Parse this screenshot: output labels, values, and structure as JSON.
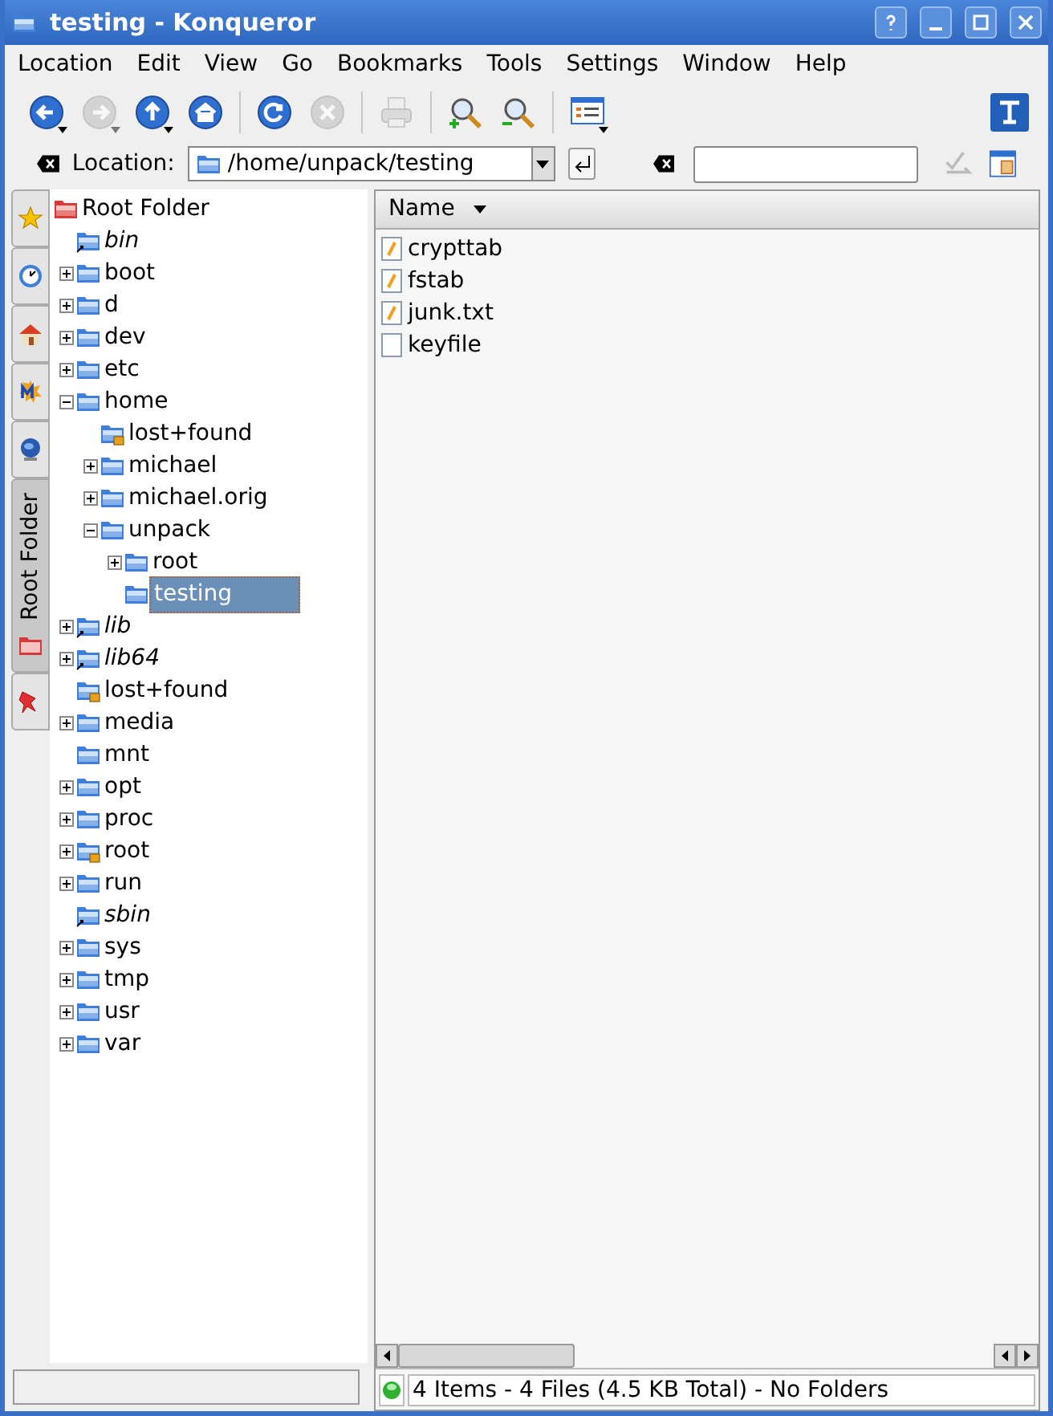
{
  "window": {
    "title": "testing - Konqueror"
  },
  "menu": [
    "Location",
    "Edit",
    "View",
    "Go",
    "Bookmarks",
    "Tools",
    "Settings",
    "Window",
    "Help"
  ],
  "toolbar": [
    {
      "kind": "back",
      "disabled": false,
      "dropdown": true
    },
    {
      "kind": "forward",
      "disabled": true,
      "dropdown": true
    },
    {
      "kind": "up",
      "disabled": false,
      "dropdown": true
    },
    {
      "kind": "home",
      "disabled": false,
      "dropdown": false
    },
    {
      "kind": "sep"
    },
    {
      "kind": "reload",
      "disabled": false,
      "dropdown": false
    },
    {
      "kind": "stop",
      "disabled": true,
      "dropdown": false
    },
    {
      "kind": "sep"
    },
    {
      "kind": "print",
      "disabled": true,
      "dropdown": false
    },
    {
      "kind": "sep"
    },
    {
      "kind": "zoomin",
      "disabled": false,
      "dropdown": false
    },
    {
      "kind": "zoomout",
      "disabled": false,
      "dropdown": false
    },
    {
      "kind": "sep"
    },
    {
      "kind": "viewmode",
      "disabled": false,
      "dropdown": true
    }
  ],
  "location": {
    "label": "Location:",
    "value": "/home/unpack/testing"
  },
  "sidebar_tabs": [
    {
      "kind": "bookmarks",
      "selected": false
    },
    {
      "kind": "history",
      "selected": false
    },
    {
      "kind": "home",
      "selected": false
    },
    {
      "kind": "media",
      "selected": false
    },
    {
      "kind": "network",
      "selected": false
    },
    {
      "kind": "root",
      "label": "Root Folder",
      "selected": true
    },
    {
      "kind": "services",
      "selected": false
    }
  ],
  "tree": {
    "label": "Root Folder",
    "children": [
      {
        "label": "bin",
        "kind": "symlink",
        "selected": false
      },
      {
        "label": "boot",
        "kind": "folder",
        "expanded": false,
        "selected": false
      },
      {
        "label": "d",
        "kind": "folder",
        "expanded": false,
        "selected": false
      },
      {
        "label": "dev",
        "kind": "folder",
        "expanded": false,
        "selected": false
      },
      {
        "label": "etc",
        "kind": "folder",
        "expanded": false,
        "selected": false
      },
      {
        "label": "home",
        "kind": "folder",
        "expanded": true,
        "selected": false,
        "children": [
          {
            "label": "lost+found",
            "kind": "locked",
            "selected": false
          },
          {
            "label": "michael",
            "kind": "folder",
            "expanded": false,
            "selected": false
          },
          {
            "label": "michael.orig",
            "kind": "folder",
            "expanded": false,
            "selected": false
          },
          {
            "label": "unpack",
            "kind": "folder",
            "expanded": true,
            "selected": false,
            "children": [
              {
                "label": "root",
                "kind": "folder",
                "expanded": false,
                "selected": false
              },
              {
                "label": "testing",
                "kind": "folder",
                "selected": true
              }
            ]
          }
        ]
      },
      {
        "label": "lib",
        "kind": "symlink",
        "expanded": false,
        "selected": false
      },
      {
        "label": "lib64",
        "kind": "symlink",
        "expanded": false,
        "selected": false
      },
      {
        "label": "lost+found",
        "kind": "locked",
        "selected": false
      },
      {
        "label": "media",
        "kind": "folder",
        "expanded": false,
        "selected": false
      },
      {
        "label": "mnt",
        "kind": "folder",
        "selected": false
      },
      {
        "label": "opt",
        "kind": "folder",
        "expanded": false,
        "selected": false
      },
      {
        "label": "proc",
        "kind": "folder",
        "expanded": false,
        "selected": false
      },
      {
        "label": "root",
        "kind": "locked",
        "expanded": false,
        "selected": false
      },
      {
        "label": "run",
        "kind": "folder",
        "expanded": false,
        "selected": false
      },
      {
        "label": "sbin",
        "kind": "symlink",
        "selected": false
      },
      {
        "label": "sys",
        "kind": "folder",
        "expanded": false,
        "selected": false
      },
      {
        "label": "tmp",
        "kind": "folder",
        "expanded": false,
        "selected": false
      },
      {
        "label": "usr",
        "kind": "folder",
        "expanded": false,
        "selected": false
      },
      {
        "label": "var",
        "kind": "folder",
        "expanded": false,
        "selected": false
      }
    ]
  },
  "file_list": {
    "column": "Name",
    "files": [
      {
        "name": "crypttab",
        "kind": "text"
      },
      {
        "name": "fstab",
        "kind": "text"
      },
      {
        "name": "junk.txt",
        "kind": "text"
      },
      {
        "name": "keyfile",
        "kind": "blank"
      }
    ]
  },
  "status_bar": {
    "text": "4 Items - 4 Files (4.5 KB Total) - No Folders"
  }
}
